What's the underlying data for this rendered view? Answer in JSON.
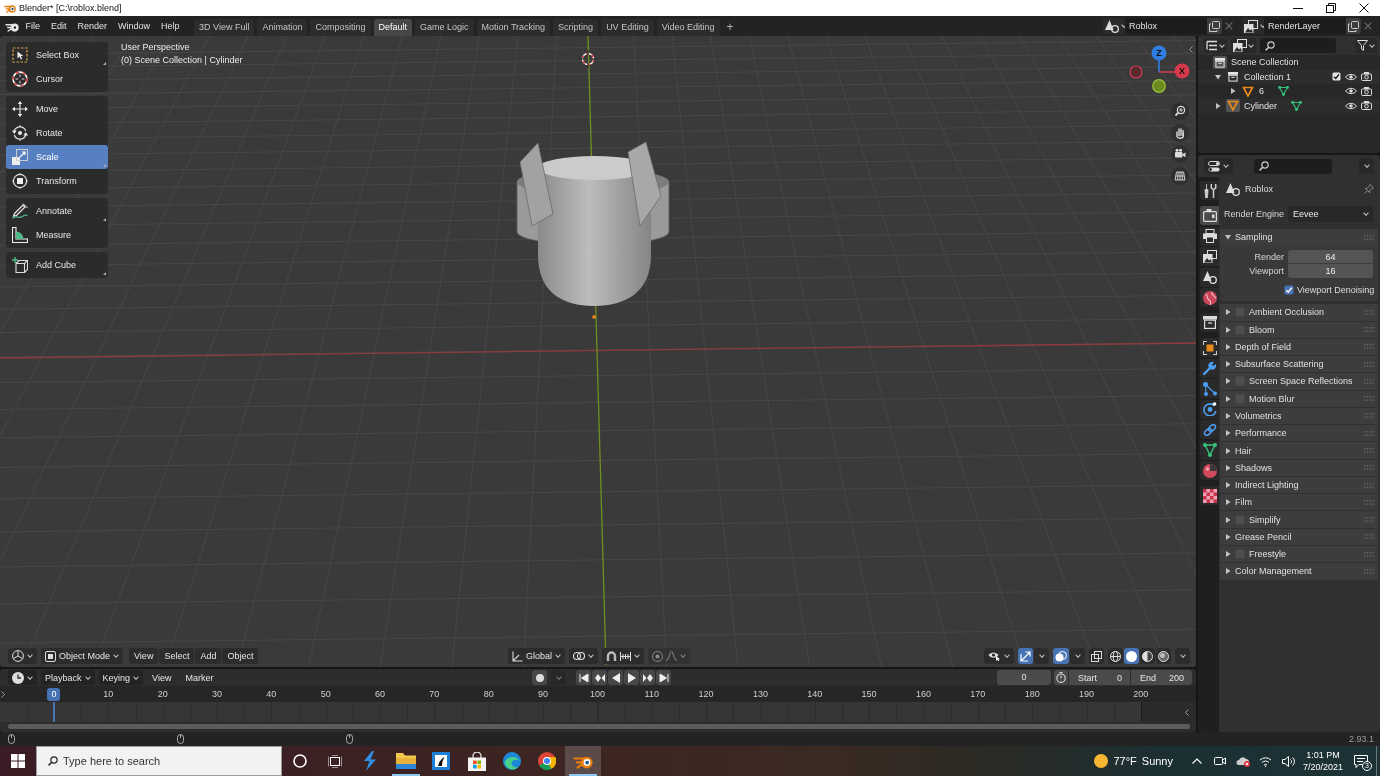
{
  "title_bar": {
    "title": "Blender* [C:\\roblox.blend]"
  },
  "top_bar": {
    "menus": [
      "File",
      "Edit",
      "Render",
      "Window",
      "Help"
    ],
    "workspaces": [
      {
        "label": "3D View Full",
        "selected": false
      },
      {
        "label": "Animation",
        "selected": false
      },
      {
        "label": "Compositing",
        "selected": false
      },
      {
        "label": "Default",
        "selected": true
      },
      {
        "label": "Game Logic",
        "selected": false
      },
      {
        "label": "Motion Tracking",
        "selected": false
      },
      {
        "label": "Scripting",
        "selected": false
      },
      {
        "label": "UV Editing",
        "selected": false
      },
      {
        "label": "Video Editing",
        "selected": false
      }
    ],
    "add_workspace": "+",
    "scene": "Roblox",
    "view_layer": "RenderLayer"
  },
  "viewport": {
    "overlay_lines": [
      "User Perspective",
      "(0) Scene Collection | Cylinder"
    ],
    "tool_groups": [
      {
        "tools": [
          {
            "label": "Select Box",
            "kind": "select",
            "selected": false,
            "has_variants": true
          },
          {
            "label": "Cursor",
            "kind": "cursor",
            "selected": false,
            "has_variants": false
          }
        ]
      },
      {
        "tools": [
          {
            "label": "Move",
            "kind": "move",
            "selected": false,
            "has_variants": false
          },
          {
            "label": "Rotate",
            "kind": "rotate",
            "selected": false,
            "has_variants": false
          },
          {
            "label": "Scale",
            "kind": "scale",
            "selected": true,
            "has_variants": true
          },
          {
            "label": "Transform",
            "kind": "transform",
            "selected": false,
            "has_variants": false
          }
        ]
      },
      {
        "tools": [
          {
            "label": "Annotate",
            "kind": "annotate",
            "selected": false,
            "has_variants": true
          },
          {
            "label": "Measure",
            "kind": "measure",
            "selected": false,
            "has_variants": false
          }
        ]
      },
      {
        "tools": [
          {
            "label": "Add Cube",
            "kind": "add_cube",
            "selected": false,
            "has_variants": true
          }
        ]
      }
    ],
    "gizmo": {
      "z_label": "Z",
      "x_label": "X"
    },
    "header": {
      "mode": "Object Mode",
      "menus": [
        "View",
        "Select",
        "Add",
        "Object"
      ],
      "orientation": "Global",
      "gizmos_on": true,
      "overlays_on": true,
      "shading": [
        {
          "kind": "wireframe",
          "selected": false
        },
        {
          "kind": "solid",
          "selected": true
        },
        {
          "kind": "material",
          "selected": false
        },
        {
          "kind": "rendered",
          "selected": false
        }
      ]
    }
  },
  "timeline": {
    "menus": [
      {
        "label": "Playback",
        "kind": "dropdown"
      },
      {
        "label": "Keying",
        "kind": "dropdown"
      },
      {
        "label": "View",
        "kind": "menu"
      },
      {
        "label": "Marker",
        "kind": "menu"
      }
    ],
    "current_frame": "0",
    "start_label": "Start",
    "start": "0",
    "end_label": "End",
    "end": "200",
    "frames": [
      {
        "label": "0",
        "selected": true
      },
      {
        "label": "10",
        "selected": false
      },
      {
        "label": "20",
        "selected": false
      },
      {
        "label": "30",
        "selected": false
      },
      {
        "label": "40",
        "selected": false
      },
      {
        "label": "50",
        "selected": false
      },
      {
        "label": "60",
        "selected": false
      },
      {
        "label": "70",
        "selected": false
      },
      {
        "label": "80",
        "selected": false
      },
      {
        "label": "90",
        "selected": false
      },
      {
        "label": "100",
        "selected": false
      },
      {
        "label": "110",
        "selected": false
      },
      {
        "label": "120",
        "selected": false
      },
      {
        "label": "130",
        "selected": false
      },
      {
        "label": "140",
        "selected": false
      },
      {
        "label": "150",
        "selected": false
      },
      {
        "label": "160",
        "selected": false
      },
      {
        "label": "170",
        "selected": false
      },
      {
        "label": "180",
        "selected": false
      },
      {
        "label": "190",
        "selected": false
      },
      {
        "label": "200",
        "selected": false
      }
    ]
  },
  "outliner": {
    "tree": [
      {
        "label": "Scene Collection",
        "kind": "scene",
        "active": true,
        "children": [
          {
            "label": "Collection 1",
            "kind": "collection",
            "expanded": true,
            "checked": true,
            "active": false,
            "children": [
              {
                "label": "6",
                "kind": "object",
                "expanded": false,
                "active": false
              }
            ]
          },
          {
            "label": "Cylinder",
            "kind": "object",
            "expanded": false,
            "active": true
          }
        ]
      }
    ]
  },
  "properties": {
    "context": "Roblox",
    "tab_groups": [
      {
        "tabs": [
          {
            "kind": "tool",
            "selected": false
          }
        ]
      },
      {
        "tabs": [
          {
            "kind": "render",
            "selected": true
          },
          {
            "kind": "output",
            "selected": false
          },
          {
            "kind": "view_layer",
            "selected": false
          },
          {
            "kind": "scene",
            "selected": false
          },
          {
            "kind": "world",
            "selected": false
          }
        ]
      },
      {
        "tabs": [
          {
            "kind": "collection",
            "selected": false
          }
        ]
      },
      {
        "tabs": [
          {
            "kind": "object",
            "selected": false
          },
          {
            "kind": "modifiers",
            "selected": false
          },
          {
            "kind": "particles",
            "selected": false
          },
          {
            "kind": "physics",
            "selected": false
          },
          {
            "kind": "constraints",
            "selected": false
          },
          {
            "kind": "data",
            "selected": false
          },
          {
            "kind": "material",
            "selected": false
          }
        ]
      },
      {
        "tabs": [
          {
            "kind": "texture",
            "selected": false
          }
        ]
      }
    ],
    "render_engine_label": "Render Engine",
    "render_engine": "Eevee",
    "sampling": {
      "label": "Sampling",
      "expanded": true,
      "fields": [
        {
          "label": "Render",
          "value": "64"
        },
        {
          "label": "Viewport",
          "value": "16"
        }
      ],
      "denoising": {
        "label": "Viewport Denoising",
        "checked": true
      }
    },
    "panels": [
      {
        "label": "Ambient Occlusion",
        "kind": "toggle",
        "checked": false,
        "expanded": false
      },
      {
        "label": "Bloom",
        "kind": "toggle",
        "checked": false,
        "expanded": false
      },
      {
        "label": "Depth of Field",
        "kind": "plain",
        "expanded": false
      },
      {
        "label": "Subsurface Scattering",
        "kind": "plain",
        "expanded": false
      },
      {
        "label": "Screen Space Reflections",
        "kind": "toggle",
        "checked": false,
        "expanded": false
      },
      {
        "label": "Motion Blur",
        "kind": "toggle",
        "checked": false,
        "expanded": false
      },
      {
        "label": "Volumetrics",
        "kind": "plain",
        "expanded": false
      },
      {
        "label": "Performance",
        "kind": "plain",
        "expanded": false
      },
      {
        "label": "Hair",
        "kind": "plain",
        "expanded": false
      },
      {
        "label": "Shadows",
        "kind": "plain",
        "expanded": false
      },
      {
        "label": "Indirect Lighting",
        "kind": "plain",
        "expanded": false
      },
      {
        "label": "Film",
        "kind": "plain",
        "expanded": false
      },
      {
        "label": "Simplify",
        "kind": "toggle",
        "checked": false,
        "expanded": false
      },
      {
        "label": "Grease Pencil",
        "kind": "plain",
        "expanded": false
      },
      {
        "label": "Freestyle",
        "kind": "toggle",
        "checked": false,
        "expanded": false
      },
      {
        "label": "Color Management",
        "kind": "plain",
        "expanded": false
      }
    ]
  },
  "status_bar": {
    "version": "2.93.1"
  },
  "taskbar": {
    "search": {
      "placeholder": "Type here to search"
    },
    "apps": [
      {
        "kind": "bolt",
        "running": false,
        "active": false
      },
      {
        "kind": "folder",
        "running": true,
        "active": false
      },
      {
        "kind": "badge",
        "running": false,
        "active": false
      },
      {
        "kind": "bag",
        "running": false,
        "active": false
      },
      {
        "kind": "swirl",
        "running": false,
        "active": false
      },
      {
        "kind": "wheel",
        "running": false,
        "active": false
      },
      {
        "kind": "blender",
        "running": true,
        "active": true
      }
    ],
    "weather": {
      "temperature": "77°F",
      "condition": "Sunny"
    },
    "time": "1:01 PM",
    "date": "7/20/2021",
    "notifications": "3"
  }
}
